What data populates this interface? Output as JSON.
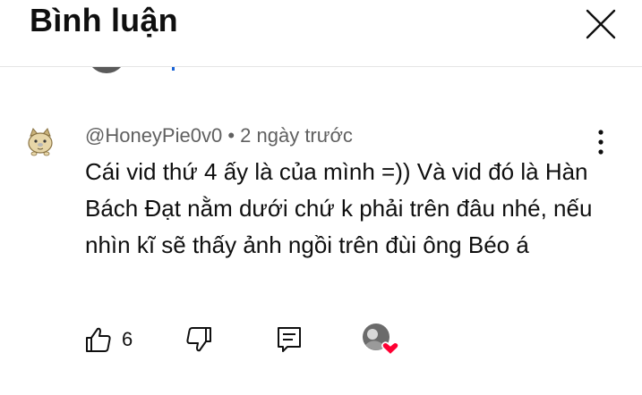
{
  "header": {
    "title": "Bình luận",
    "close_icon": "close-icon"
  },
  "comment": {
    "author": "@HoneyPie0v0",
    "separator": "•",
    "time": "2 ngày trước",
    "text": "Cái vid thứ 4 ấy là của mình =)) Và vid đó là Hàn Bách Đạt nằm dưới chứ k phải trên đâu nhé, nếu nhìn kĩ sẽ thấy ảnh ngồi trên đùi ông Béo á",
    "like_count": "6",
    "icons": {
      "avatar": "cat-avatar-icon",
      "more": "more-vertical-icon",
      "like": "thumbs-up-icon",
      "dislike": "thumbs-down-icon",
      "reply": "reply-icon",
      "creator_heart": "creator-heart-icon"
    }
  },
  "colors": {
    "text_primary": "#0f0f0f",
    "text_secondary": "#606060",
    "heart": "#ff0033",
    "divider": "#e5e5e5"
  }
}
